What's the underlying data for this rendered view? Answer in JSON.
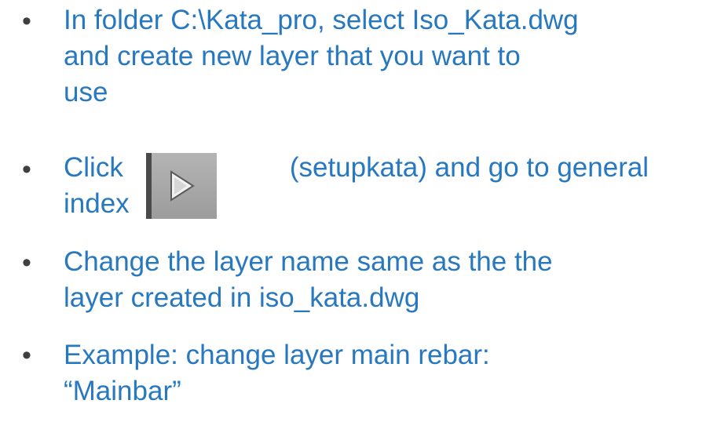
{
  "bullet_glyph": "•",
  "items": [
    {
      "lines": [
        "In folder C:\\Kata_pro, select Iso_Kata.dwg",
        "and create new layer that you want to",
        "use"
      ]
    },
    {
      "before_icon": "Click",
      "after_icon": "(setupkata) and go to general",
      "line2": "index",
      "icon": "play-arrow-icon"
    },
    {
      "lines": [
        "Change the layer name same as the the",
        "layer created in iso_kata.dwg"
      ]
    },
    {
      "lines": [
        "Example: change layer main rebar:",
        "“Mainbar”"
      ]
    }
  ],
  "colors": {
    "text": "#2778bf",
    "bullet": "#3f3f3f",
    "icon_bg": "#a8a8a8"
  }
}
